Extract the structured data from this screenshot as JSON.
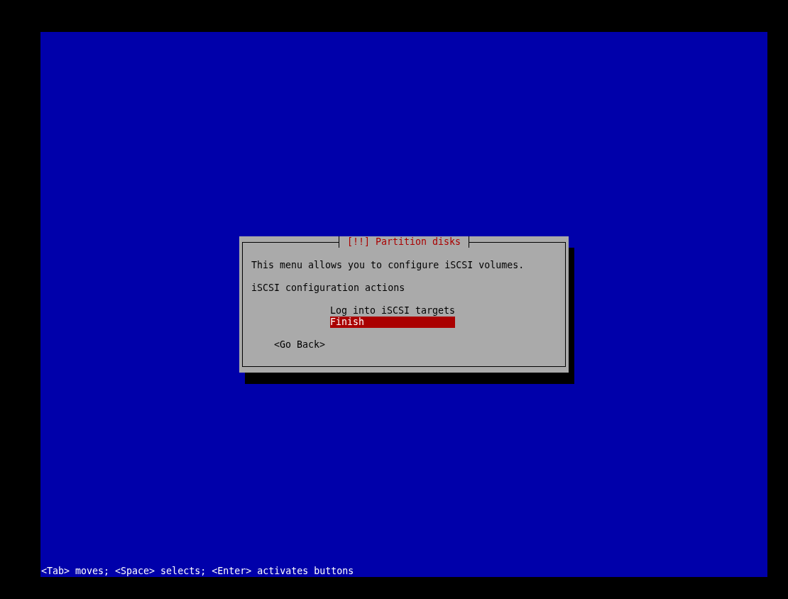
{
  "dialog": {
    "title": "[!!] Partition disks",
    "message": "This menu allows you to configure iSCSI volumes.",
    "prompt": "iSCSI configuration actions",
    "menu_items": [
      {
        "label": "Log into iSCSI targets",
        "selected": false
      },
      {
        "label": "Finish",
        "selected": true
      }
    ],
    "buttons": [
      "<Go Back>"
    ]
  },
  "status_bar": "<Tab> moves; <Space> selects; <Enter> activates buttons"
}
